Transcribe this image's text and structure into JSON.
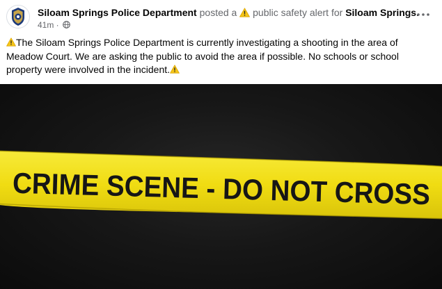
{
  "post": {
    "author": "Siloam Springs Police Department",
    "action_text": " posted a ",
    "alert_label": " public safety alert for ",
    "group_name": "Siloam Springs.",
    "timestamp": "41m",
    "separator": " · ",
    "privacy_icon": "globe-icon",
    "alert_icon": "warning-icon",
    "more_icon": "more-dots-icon",
    "body_text": "The Siloam Springs Police Department is currently investigating a shooting in the area of Meadow Court. We are asking the public to avoid the area if possible. No schools or school property were involved in the incident.",
    "image": {
      "tape_text": "CRIME SCENE - DO NOT CROSS",
      "tape_color": "#f3e117",
      "background_color": "#151515"
    }
  },
  "colors": {
    "text_primary": "#050505",
    "text_secondary": "#65676b",
    "warning_yellow": "#f5c518"
  }
}
